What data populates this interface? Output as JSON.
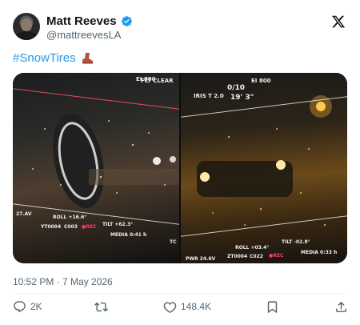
{
  "author": {
    "name": "Matt Reeves",
    "handle": "@mattreevesLA"
  },
  "tweet": {
    "hashtag": "#SnowTires",
    "emoji_icon": "boot-icon"
  },
  "media": {
    "left": {
      "ei": "EI 800",
      "flt": "FLT CLEAR",
      "fps": "27.AV",
      "roll": "ROLL +16.6°",
      "tilt": "TILT +62.3°",
      "clip_a": "YT0004",
      "clip_b": "C003",
      "rec": "●REC",
      "media": "MEDIA 0:41 h",
      "tc": "TC"
    },
    "right": {
      "iris": "IRIS T 2.0",
      "shutter": "0/10",
      "focus": "19' 3\"",
      "ei": "EI 800",
      "pwr": "PWR 24.6V",
      "roll": "ROLL +03.4°",
      "tilt": "TILT -02.8°",
      "clip_a": "ZT0004",
      "clip_b": "C022",
      "rec": "●REC",
      "media": "MEDIA 0:33 h"
    }
  },
  "timestamp": "10:52 PM · 7 May 2026",
  "actions": {
    "replies": "2K",
    "reposts": "",
    "likes": "148.4K",
    "bookmark": "",
    "share": ""
  },
  "colors": {
    "accent": "#1d9bf0",
    "secondary_text": "#536471",
    "rec": "#ff3b6b"
  }
}
